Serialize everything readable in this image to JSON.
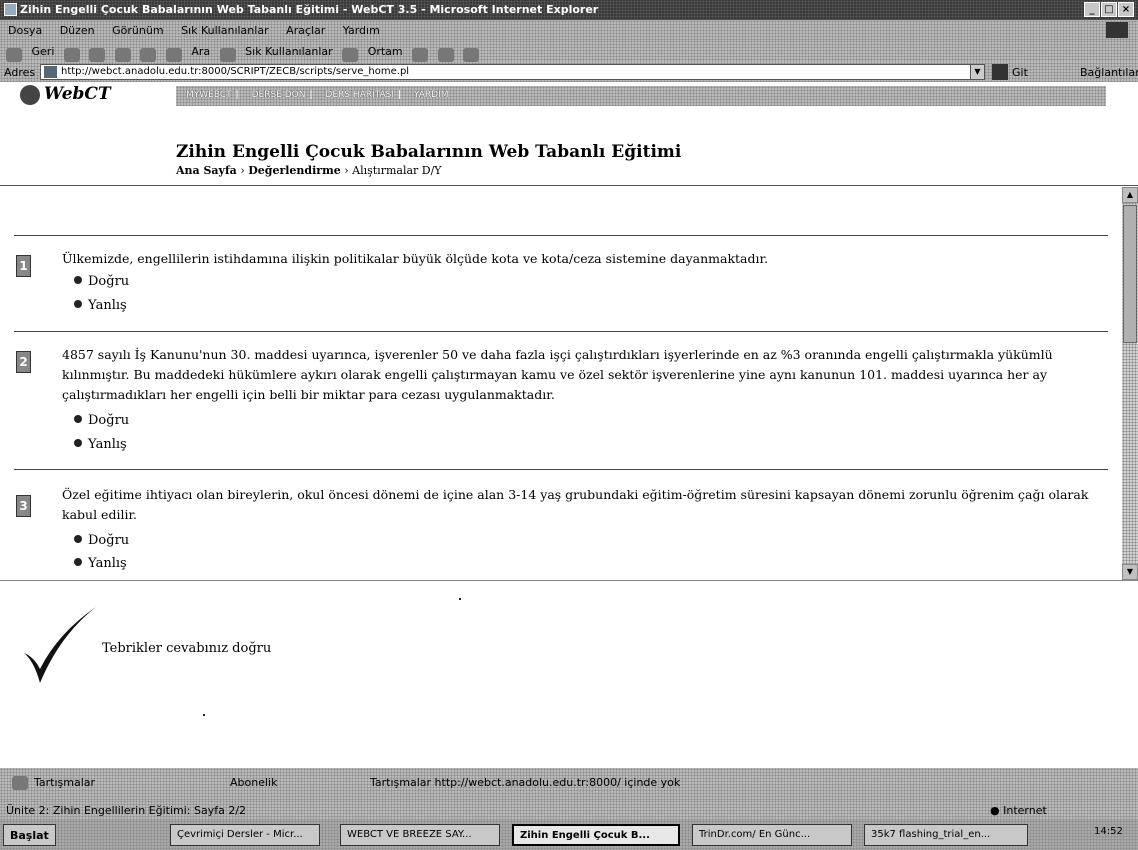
{
  "window": {
    "title": "Zihin Engelli Çocuk Babalarının Web Tabanlı Eğitimi - WebCT 3.5 - Microsoft Internet Explorer"
  },
  "menu": [
    "Dosya",
    "Düzen",
    "Görünüm",
    "Sık Kullanılanlar",
    "Araçlar",
    "Yardım"
  ],
  "toolbar": {
    "back": "Geri",
    "search": "Ara",
    "favorites": "Sık Kullanılanlar",
    "media": "Ortam"
  },
  "address": {
    "label": "Adres",
    "url": "http://webct.anadolu.edu.tr:8000/SCRIPT/ZECB/scripts/serve_home.pl",
    "go": "Git",
    "links": "Bağlantılar"
  },
  "webct": {
    "logo": "WebCT",
    "nav": [
      "MYWEBCT",
      "DERSE DÖN",
      "DERS HARİTASI",
      "YARDIM"
    ],
    "course_title": "Zihin Engelli Çocuk Babalarının Web Tabanlı Eğitimi",
    "breadcrumb": [
      "Ana Sayfa",
      "Değerlendirme",
      "Alıştırmalar D/Y"
    ]
  },
  "questions": [
    {
      "number": "1",
      "text": "Ülkemizde, engellilerin istihdamına ilişkin politikalar büyük ölçüde kota ve kota/ceza sistemine dayanmaktadır.",
      "options": [
        "Doğru",
        "Yanlış"
      ]
    },
    {
      "number": "2",
      "text": "4857 sayılı İş Kanunu'nun 30. maddesi uyarınca, işverenler 50 ve daha fazla işçi çalıştırdıkları işyerlerinde en az %3 oranında engelli çalıştırmakla yükümlü kılınmıştır. Bu maddedeki hükümlere aykırı olarak engelli çalıştırmayan kamu ve özel sektör işverenlerine yine aynı kanunun 101. maddesi uyarınca her ay çalıştırmadıkları her engelli için belli bir miktar para cezası uygulanmaktadır.",
      "options": [
        "Doğru",
        "Yanlış"
      ]
    },
    {
      "number": "3",
      "text": "Özel eğitime ihtiyacı olan bireylerin, okul öncesi dönemi de içine alan 3-14 yaş grubundaki eğitim-öğretim süresini kapsayan dönemi zorunlu öğrenim çağı olarak kabul edilir.",
      "options": [
        "Doğru",
        "Yanlış"
      ]
    }
  ],
  "feedback": {
    "message": "Tebrikler cevabınız doğru"
  },
  "discussion_bar": {
    "discussions": "Tartışmalar",
    "subscribe": "Abonelik",
    "status": "Tartışmalar http://webct.anadolu.edu.tr:8000/ içinde yok"
  },
  "status": {
    "left": "Ünite 2: Zihin Engellilerin Eğitimi: Sayfa 2/2",
    "zone": "Internet"
  },
  "taskbar": {
    "start": "Başlat",
    "tasks": [
      "Çevrimiçi Dersler - Micr...",
      "WEBCT VE BREEZE SAY...",
      "Zihin Engelli Çocuk B...",
      "TrinDr.com/ En Günc...",
      "35k7 flashing_trial_en..."
    ],
    "clock": "14:52"
  }
}
